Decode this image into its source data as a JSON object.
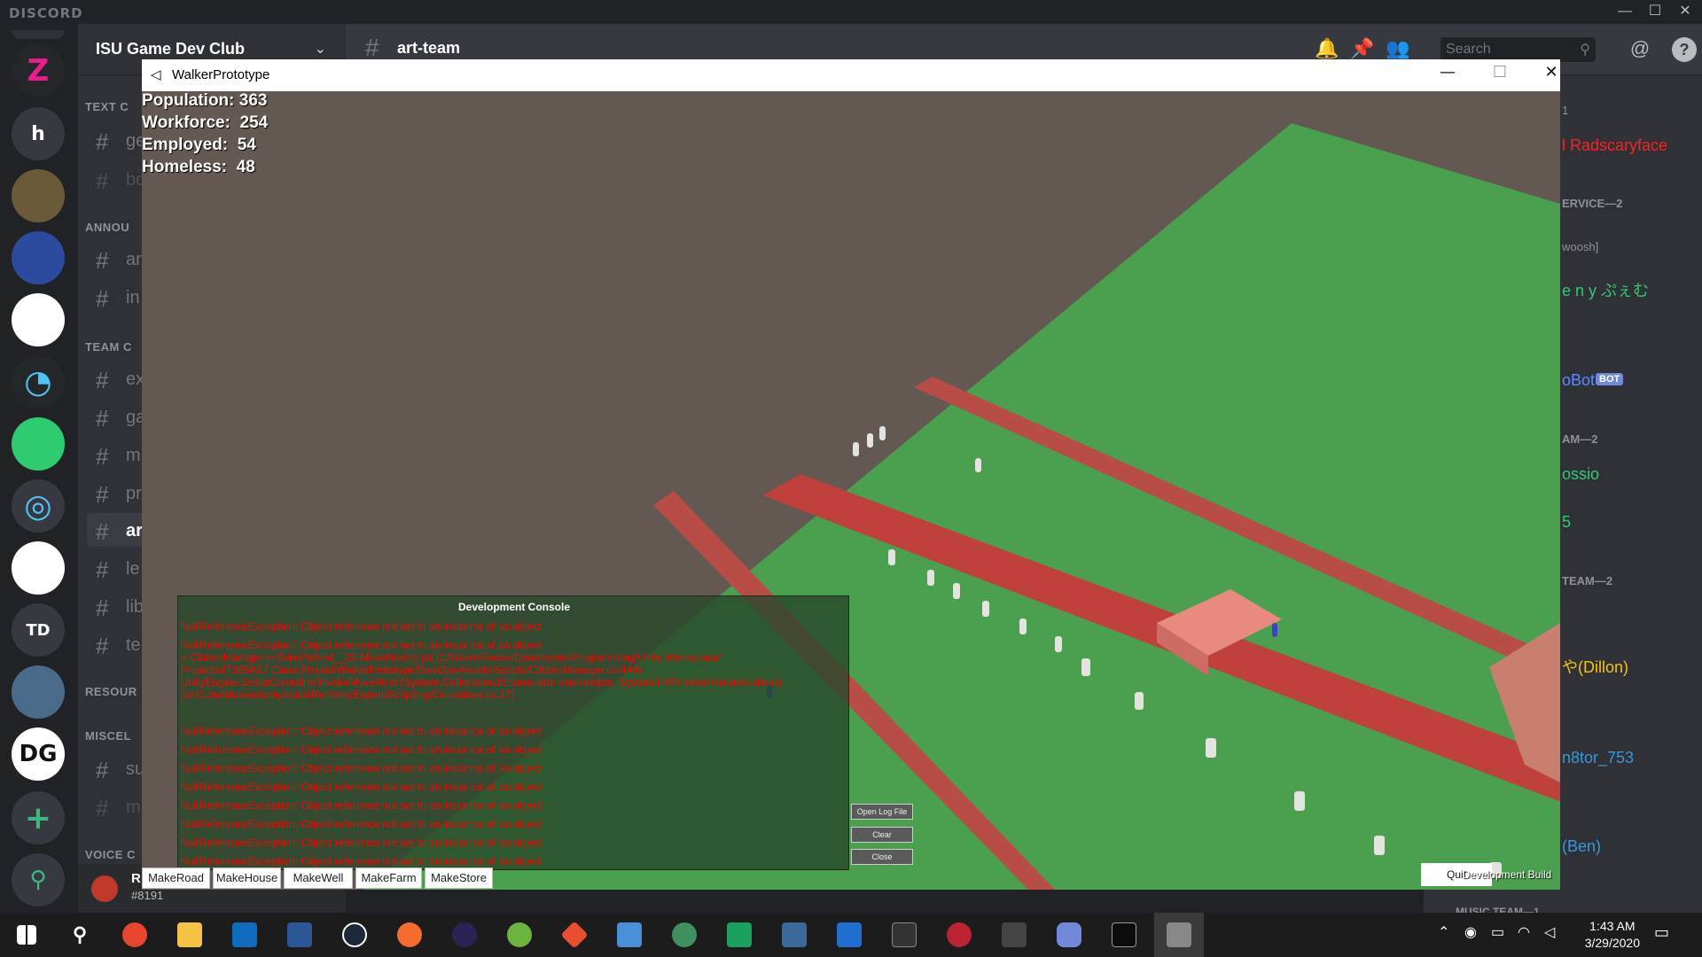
{
  "discord": {
    "brand": "DISCORD",
    "server_name": "ISU Game Dev Club",
    "channel_name": "art-team",
    "search_placeholder": "Search",
    "guild_labels": [
      "Z",
      "h",
      "TD"
    ],
    "categories": [
      "TEXT C",
      "ANNOU",
      "TEAM C",
      "RESOUR",
      "MISCEL",
      "VOICE C"
    ],
    "channels": [
      "ge",
      "bo",
      "an",
      "in",
      "ex",
      "ga",
      "m",
      "pr",
      "ar",
      "le",
      "lib",
      "te",
      "su",
      "m"
    ],
    "user": {
      "name": "R",
      "tag": "#8191"
    },
    "members": [
      {
        "text": "1",
        "color": "#8e9297"
      },
      {
        "text": "l Radscaryface",
        "color": "#ff2020"
      },
      {
        "text": "ERVICE—2",
        "color": "#8e9297"
      },
      {
        "text": "woosh]",
        "color": "#8e9297"
      },
      {
        "text": "e n y ぷぇむ",
        "color": "#2ecc71"
      },
      {
        "text": "oBot",
        "color": "#5d8aff"
      },
      {
        "text": "BOT",
        "color": "#ffffff"
      },
      {
        "text": "AM—2",
        "color": "#8e9297"
      },
      {
        "text": "ossio",
        "color": "#2ecc71"
      },
      {
        "text": "5",
        "color": "#2ecc71"
      },
      {
        "text": "TEAM—2",
        "color": "#8e9297"
      },
      {
        "text": "や(Dillon)",
        "color": "#f1c40f"
      },
      {
        "text": "n8tor_753",
        "color": "#3498db"
      },
      {
        "text": "(Ben)",
        "color": "#3498db"
      },
      {
        "text": "MUSIC TEAM—1",
        "color": "#8e9297"
      }
    ]
  },
  "game": {
    "window_title": "WalkerPrototype",
    "hud": [
      {
        "label": "Population:",
        "value": "363"
      },
      {
        "label": "Workforce:",
        "value": "254"
      },
      {
        "label": "Employed:",
        "value": "54"
      },
      {
        "label": "Homeless:",
        "value": "48"
      }
    ],
    "console": {
      "title": "Development Console",
      "lines": [
        "NullReferenceException: Object reference not set to an instance of an object",
        "NullReferenceException: Object reference not set to an instance of an object",
        "> CitizenManager+<TakePath>d__29.MoveNext () (at C:/Users/Reese/Documents/Programming/Unity Workspace/",
        "Projects/IT385A17 Class Project/WalkerPrototype/DevOps/Assets/Scripts/CitizenManager.cs:440)",
        "UnityEngine.SetupCoroutine.InvokeMoveNext (System.Collections.IEnumerator enumerator, System.IntPtr returnValueAddress)",
        "(at C:/buildslave/unity/build/Runtime/Export/Scripting/Coroutines.cs:17)",
        "NullReferenceException: Object reference not set to an instance of an object",
        "NullReferenceException: Object reference not set to an instance of an object",
        "NullReferenceException: Object reference not set to an instance of an object",
        "NullReferenceException: Object reference not set to an instance of an object",
        "NullReferenceException: Object reference not set to an instance of an object",
        "NullReferenceException: Object reference not set to an instance of an object",
        "NullReferenceException: Object reference not set to an instance of an object",
        "NullReferenceException: Object reference not set to an instance of an object"
      ],
      "buttons": [
        "Open Log File",
        "Clear",
        "Close"
      ]
    },
    "make_buttons": [
      "MakeRoad",
      "MakeHouse",
      "MakeWell",
      "MakeFarm",
      "MakeStore"
    ],
    "bottom_right": [
      "Quit",
      "Development Build"
    ]
  },
  "taskbar": {
    "time": "1:43 AM",
    "date": "3/29/2020"
  }
}
